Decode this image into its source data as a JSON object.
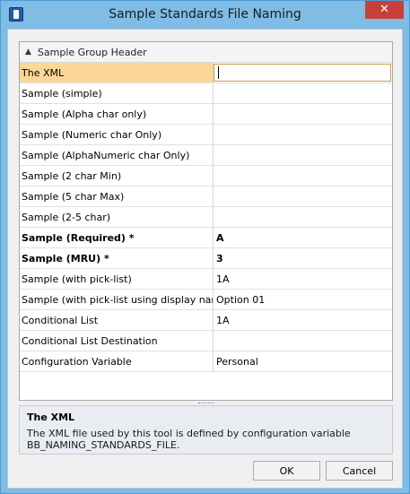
{
  "window": {
    "title": "Sample Standards File Naming",
    "close_label": "✕"
  },
  "group": {
    "label": "Sample Group Header"
  },
  "rows": [
    {
      "name": "The XML",
      "value": "",
      "selected": true,
      "bold": false
    },
    {
      "name": "Sample (simple)",
      "value": "",
      "selected": false,
      "bold": false
    },
    {
      "name": "Sample (Alpha char only)",
      "value": "",
      "selected": false,
      "bold": false
    },
    {
      "name": "Sample (Numeric char Only)",
      "value": "",
      "selected": false,
      "bold": false
    },
    {
      "name": "Sample (AlphaNumeric char Only)",
      "value": "",
      "selected": false,
      "bold": false
    },
    {
      "name": "Sample (2 char Min)",
      "value": "",
      "selected": false,
      "bold": false
    },
    {
      "name": "Sample (5 char Max)",
      "value": "",
      "selected": false,
      "bold": false
    },
    {
      "name": "Sample (2-5 char)",
      "value": "",
      "selected": false,
      "bold": false
    },
    {
      "name": "Sample (Required) *",
      "value": "A",
      "selected": false,
      "bold": true
    },
    {
      "name": "Sample (MRU) *",
      "value": "3",
      "selected": false,
      "bold": true
    },
    {
      "name": "Sample (with pick-list)",
      "value": "1A",
      "selected": false,
      "bold": false
    },
    {
      "name": "Sample (with pick-list using display nam...",
      "value": "Option 01",
      "selected": false,
      "bold": false
    },
    {
      "name": "Conditional List",
      "value": "1A",
      "selected": false,
      "bold": false
    },
    {
      "name": "Conditional List Destination",
      "value": "",
      "selected": false,
      "bold": false
    },
    {
      "name": "Configuration Variable",
      "value": "Personal",
      "selected": false,
      "bold": false
    }
  ],
  "description": {
    "title": "The XML",
    "text": "The XML file used by this tool is defined by configuration variable BB_NAMING_STANDARDS_FILE."
  },
  "buttons": {
    "ok": "OK",
    "cancel": "Cancel"
  },
  "colors": {
    "selected_row": "#fbd797",
    "title_bar": "#7fbce6",
    "close_button": "#c7403a"
  }
}
